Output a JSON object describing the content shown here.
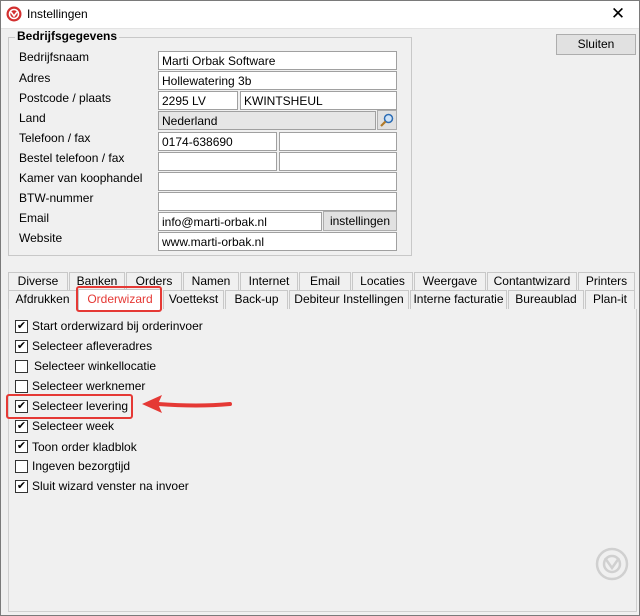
{
  "window": {
    "title": "Instellingen",
    "close_glyph": "✕"
  },
  "company_group": {
    "title": "Bedrijfsgegevens",
    "labels": {
      "name": "Bedrijfsnaam",
      "address": "Adres",
      "postcode_city": "Postcode / plaats",
      "country": "Land",
      "phone_fax": "Telefoon / fax",
      "order_phone_fax": "Bestel telefoon / fax",
      "chamber": "Kamer van koophandel",
      "vat": "BTW-nummer",
      "email": "Email",
      "website": "Website"
    },
    "values": {
      "name": "Marti Orbak Software",
      "address": "Hollewatering 3b",
      "postcode": "2295 LV",
      "city": "KWINTSHEUL",
      "country": "Nederland",
      "phone": "0174-638690",
      "fax": "",
      "order_phone": "",
      "order_fax": "",
      "chamber": "",
      "vat": "",
      "email": "info@marti-orbak.nl",
      "website": "www.marti-orbak.nl"
    },
    "email_settings_button": "instellingen",
    "country_lookup_icon": "search-icon"
  },
  "close_button": "Sluiten",
  "tabs_row1": [
    "Diverse",
    "Banken",
    "Orders",
    "Namen",
    "Internet",
    "Email",
    "Locaties",
    "Weergave",
    "Contantwizard",
    "Printers"
  ],
  "tabs_row2": [
    "Afdrukken",
    "Orderwizard",
    "Voettekst",
    "Back-up",
    "Debiteur Instellingen",
    "Interne facturatie",
    "Bureaublad",
    "Plan-it"
  ],
  "active_tab": "Orderwizard",
  "checkboxes": [
    {
      "label": "Start orderwizard bij orderinvoer",
      "checked": true
    },
    {
      "label": "Selecteer afleveradres",
      "checked": true
    },
    {
      "label": "Selecteer winkellocatie",
      "checked": false
    },
    {
      "label": "Selecteer werknemer",
      "checked": false
    },
    {
      "label": "Selecteer levering",
      "checked": true
    },
    {
      "label": "Selecteer week",
      "checked": true
    },
    {
      "label": "Toon order kladblok",
      "checked": true
    },
    {
      "label": "Ingeven bezorgtijd",
      "checked": false
    },
    {
      "label": "Sluit wizard venster na invoer",
      "checked": true
    }
  ],
  "check_glyph": "✔",
  "highlight_color": "#e53935",
  "icons": {
    "app": "app-logo-icon",
    "watermark": "watermark-logo-icon"
  }
}
